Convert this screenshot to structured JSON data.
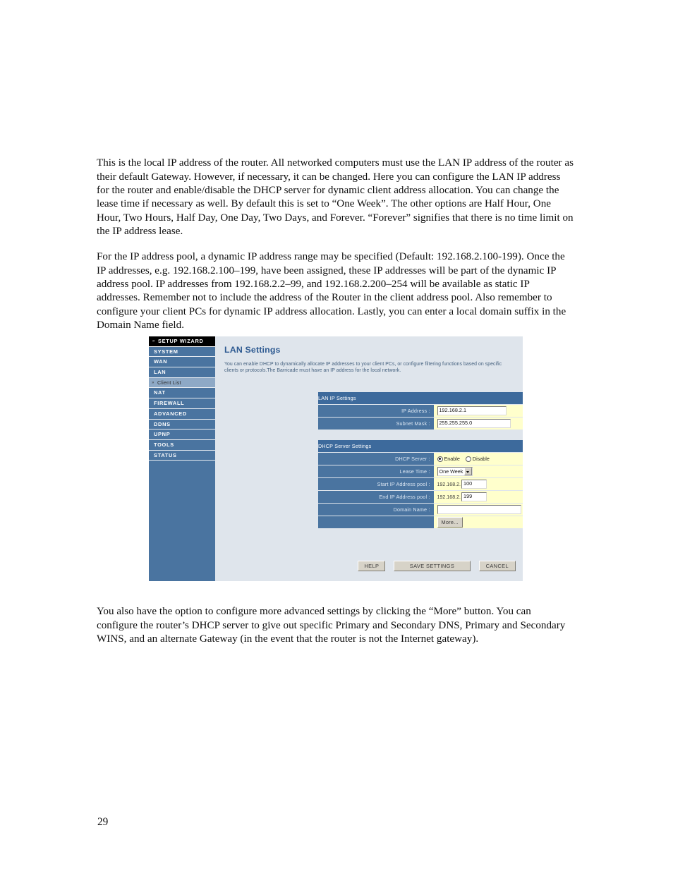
{
  "document": {
    "paragraphs": [
      "This is the local IP address of the router. All networked computers must use the LAN IP address of the router as their default Gateway. However, if necessary, it can be changed. Here you can configure the LAN IP address for the router and enable/disable the DHCP server for dynamic client address allocation. You can change the lease time if necessary as well. By default this is set to “One Week”. The other options are Half Hour, One Hour, Two Hours, Half Day, One Day, Two Days, and Forever. “Forever” signifies that there is no time limit on the IP address lease.",
      "For the IP address pool, a dynamic IP address range may be specified (Default: 192.168.2.100-199). Once the IP addresses, e.g. 192.168.2.100–199, have been assigned, these IP addresses will be part of the dynamic IP address pool. IP addresses from 192.168.2.2–99, and 192.168.2.200–254 will be available as static IP addresses. Remember not to include the address of the Router in the client address pool. Also remember to configure your client PCs for dynamic IP address allocation. Lastly, you can enter a local domain suffix in the Domain Name field.",
      "You also have the option to configure more advanced settings by clicking the “More” button. You can configure the router’s DHCP server to give out specific Primary and Secondary DNS, Primary and Secondary WINS, and an alternate Gateway (in the event that the router is not the Internet gateway)."
    ],
    "page_number": "29"
  },
  "screenshot": {
    "sidebar": {
      "items": [
        {
          "label": "SETUP WIZARD",
          "type": "wizard",
          "marker": "»"
        },
        {
          "label": "SYSTEM",
          "type": "main"
        },
        {
          "label": "WAN",
          "type": "main"
        },
        {
          "label": "LAN",
          "type": "main"
        },
        {
          "label": "Client List",
          "type": "sub",
          "marker": "»"
        },
        {
          "label": "NAT",
          "type": "main"
        },
        {
          "label": "FIREWALL",
          "type": "main"
        },
        {
          "label": "ADVANCED",
          "type": "main"
        },
        {
          "label": "DDNS",
          "type": "main"
        },
        {
          "label": "UPnP",
          "type": "main"
        },
        {
          "label": "TOOLS",
          "type": "main"
        },
        {
          "label": "STATUS",
          "type": "main"
        }
      ]
    },
    "main": {
      "title": "LAN Settings",
      "description": "You can enable DHCP to dynamically allocate IP addresses to your client PCs, or configure filtering functions based on specific clients or protocols.The Barricade must have an IP address for the local network.",
      "lan_ip_settings": {
        "section_title": "LAN IP Settings",
        "ip_address_label": "IP Address :",
        "ip_address_value": "192.168.2.1",
        "subnet_mask_label": "Subnet Mask :",
        "subnet_mask_value": "255.255.255.0"
      },
      "dhcp_server_settings": {
        "section_title": "DHCP Server Settings",
        "dhcp_server_label": "DHCP Server :",
        "enable_label": "Enable",
        "disable_label": "Disable",
        "dhcp_selected": "Enable",
        "lease_time_label": "Lease Time :",
        "lease_time_value": "One Week",
        "lease_time_options": [
          "Half Hour",
          "One Hour",
          "Two Hours",
          "Half Day",
          "One Day",
          "Two Days",
          "One Week",
          "Forever"
        ],
        "start_pool_label": "Start IP Address pool :",
        "start_pool_prefix": "192.168.2.",
        "start_pool_value": "100",
        "end_pool_label": "End IP Address pool :",
        "end_pool_prefix": "192.168.2.",
        "end_pool_value": "199",
        "domain_name_label": "Domain Name :",
        "domain_name_value": "",
        "more_button": "More..."
      },
      "footer": {
        "help_button": "HELP",
        "save_button": "SAVE SETTINGS",
        "cancel_button": "CANCEL"
      }
    },
    "colors": {
      "sidebar_blue": "#4a74a0",
      "section_header_blue": "#3d6a9c",
      "panel_background": "#dfe5ec",
      "field_yellow": "#ffffcc",
      "title_blue": "#2f5b92",
      "wizard_black": "#000000",
      "sub_item_blue": "#8ea9c6"
    }
  }
}
